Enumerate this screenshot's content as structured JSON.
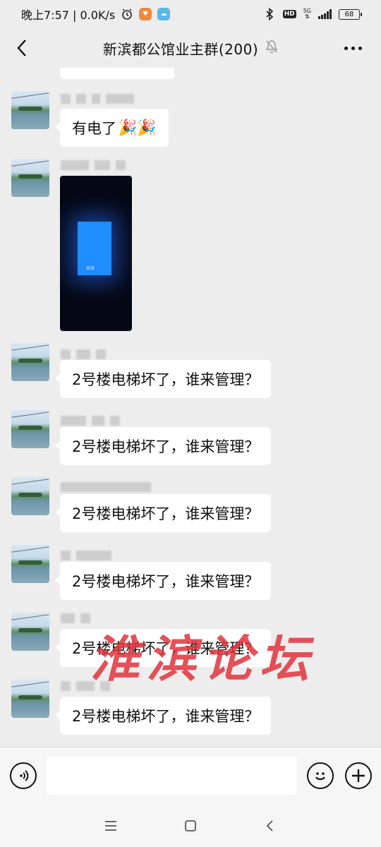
{
  "status": {
    "time_speed": "晚上7:57 | 0.0K/s",
    "hd": "HD",
    "network": "5G",
    "battery": "68"
  },
  "header": {
    "title": "新滨都公馆业主群(200)"
  },
  "messages": [
    {
      "type": "text",
      "text": "有电了",
      "emoji": "🎉🎉"
    },
    {
      "type": "image",
      "caption": "按择"
    },
    {
      "type": "text",
      "text": "2号楼电梯坏了，谁来管理？"
    },
    {
      "type": "text",
      "text": "2号楼电梯坏了，谁来管理？"
    },
    {
      "type": "text",
      "text": "2号楼电梯坏了，谁来管理？"
    },
    {
      "type": "text",
      "text": "2号楼电梯坏了，谁来管理？"
    },
    {
      "type": "text",
      "text": "2号楼电梯坏了，谁来管理？"
    },
    {
      "type": "text",
      "text": "2号楼电梯坏了，谁来管理？"
    }
  ],
  "watermark": "淮滨论坛",
  "input": {
    "placeholder": ""
  },
  "colors": {
    "background": "#ededed",
    "bubble": "#ffffff",
    "watermark": "#e1323c"
  }
}
